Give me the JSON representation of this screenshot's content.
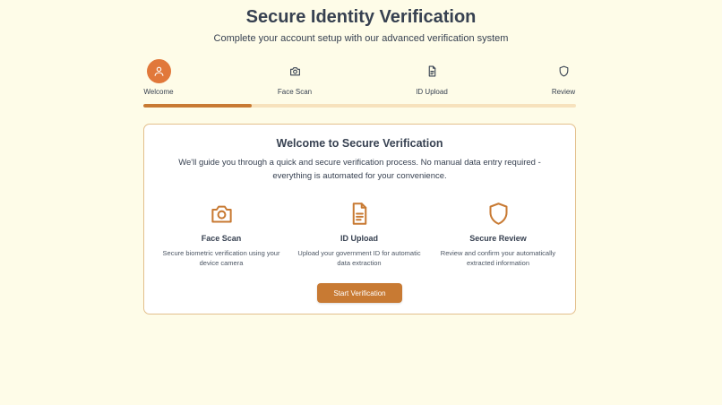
{
  "header": {
    "title": "Secure Identity Verification",
    "subtitle": "Complete your account setup with our advanced verification system"
  },
  "steps": [
    {
      "label": "Welcome",
      "icon": "user-icon",
      "active": true
    },
    {
      "label": "Face Scan",
      "icon": "camera-icon",
      "active": false
    },
    {
      "label": "ID Upload",
      "icon": "document-icon",
      "active": false
    },
    {
      "label": "Review",
      "icon": "shield-icon",
      "active": false
    }
  ],
  "progress": {
    "fraction": 0.25
  },
  "card": {
    "title": "Welcome to Secure Verification",
    "description": "We'll guide you through a quick and secure verification process. No manual data entry required - everything is automated for your convenience.",
    "features": [
      {
        "name": "Face Scan",
        "description": "Secure biometric verification using your device camera",
        "icon": "camera-icon"
      },
      {
        "name": "ID Upload",
        "description": "Upload your government ID for automatic data extraction",
        "icon": "document-icon"
      },
      {
        "name": "Secure Review",
        "description": "Review and confirm your automatically extracted information",
        "icon": "shield-icon"
      }
    ],
    "start_button": "Start Verification"
  },
  "colors": {
    "background": "#fefce8",
    "accent": "#e1783a",
    "button": "#c87a33",
    "icon": "#c87a33",
    "card_border": "#e3bf8c",
    "track": "#f7e2bd"
  }
}
